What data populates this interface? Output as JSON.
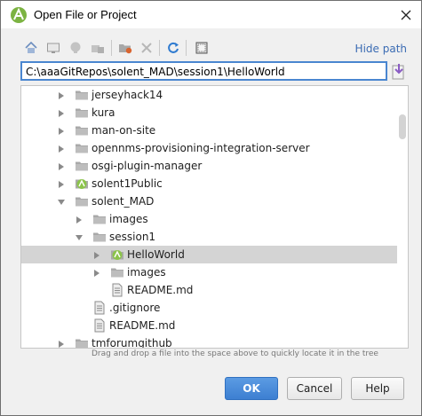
{
  "window": {
    "title": "Open File or Project"
  },
  "toolbar": {
    "buttons": [
      {
        "name": "home-button",
        "icon": "home-icon"
      },
      {
        "name": "desktop-button",
        "icon": "desktop-icon"
      },
      {
        "name": "project-button",
        "icon": "project-icon"
      },
      {
        "name": "module-button",
        "icon": "module-icon"
      },
      {
        "name": "new-folder-button",
        "icon": "new-folder-icon"
      },
      {
        "name": "delete-button",
        "icon": "delete-icon"
      },
      {
        "name": "refresh-button",
        "icon": "refresh-icon"
      },
      {
        "name": "show-hidden-button",
        "icon": "show-hidden-icon"
      }
    ],
    "hide_path_label": "Hide path"
  },
  "path": {
    "value": "C:\\aaaGitRepos\\solent_MAD\\session1\\HelloWorld"
  },
  "tree": {
    "rows": [
      {
        "label": "jerseyhack14",
        "depth": 0,
        "expander": "collapsed",
        "icon": "folder-icon",
        "selected": false
      },
      {
        "label": "kura",
        "depth": 0,
        "expander": "collapsed",
        "icon": "folder-icon",
        "selected": false
      },
      {
        "label": "man-on-site",
        "depth": 0,
        "expander": "collapsed",
        "icon": "folder-icon",
        "selected": false
      },
      {
        "label": "opennms-provisioning-integration-server",
        "depth": 0,
        "expander": "collapsed",
        "icon": "folder-icon",
        "selected": false
      },
      {
        "label": "osgi-plugin-manager",
        "depth": 0,
        "expander": "collapsed",
        "icon": "folder-icon",
        "selected": false
      },
      {
        "label": "solent1Public",
        "depth": 0,
        "expander": "collapsed",
        "icon": "android-project-icon",
        "selected": false
      },
      {
        "label": "solent_MAD",
        "depth": 0,
        "expander": "expanded",
        "icon": "folder-icon",
        "selected": false
      },
      {
        "label": "images",
        "depth": 1,
        "expander": "collapsed",
        "icon": "folder-icon",
        "selected": false
      },
      {
        "label": "session1",
        "depth": 1,
        "expander": "expanded",
        "icon": "folder-icon",
        "selected": false
      },
      {
        "label": "HelloWorld",
        "depth": 2,
        "expander": "collapsed",
        "icon": "android-project-icon",
        "selected": true
      },
      {
        "label": "images",
        "depth": 2,
        "expander": "collapsed",
        "icon": "folder-icon",
        "selected": false
      },
      {
        "label": "README.md",
        "depth": 2,
        "expander": "none",
        "icon": "file-icon",
        "selected": false
      },
      {
        "label": ".gitignore",
        "depth": 1,
        "expander": "none",
        "icon": "file-icon",
        "selected": false
      },
      {
        "label": "README.md",
        "depth": 1,
        "expander": "none",
        "icon": "file-icon",
        "selected": false
      },
      {
        "label": "tmforumgithub",
        "depth": 0,
        "expander": "collapsed",
        "icon": "folder-icon",
        "selected": false
      }
    ]
  },
  "hint": "Drag and drop a file into the space above to quickly locate it in the tree",
  "buttons": {
    "ok": "OK",
    "cancel": "Cancel",
    "help": "Help"
  },
  "colors": {
    "accent": "#4a86d0",
    "selection": "#d4d4d4",
    "link": "#3a6bb3",
    "android": "#8bc34a"
  }
}
